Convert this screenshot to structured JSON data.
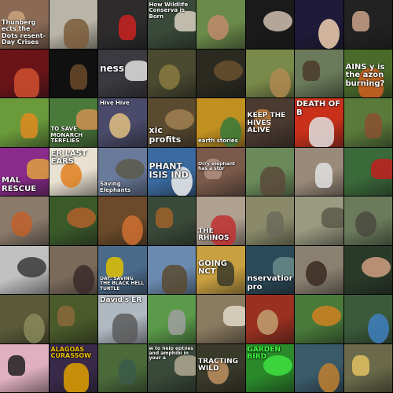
{
  "grid": {
    "cols": 8,
    "rows": 8,
    "tiles": [
      {
        "bg": "#8a6a55",
        "accent": "#c9a27c",
        "caption": "Thunberg ects the Dots resent-Day Crises",
        "cap_pos": "bottom",
        "cap_color": "#ffffff",
        "cap_size": 8
      },
      {
        "bg": "#b8b4a6",
        "accent": "#7a5a3a",
        "caption": "",
        "cap_pos": "",
        "cap_color": "#ffffff",
        "cap_size": 8
      },
      {
        "bg": "#2d2b2b",
        "accent": "#c22",
        "caption": "",
        "cap_pos": "",
        "cap_color": "#ffffff",
        "cap_size": 8
      },
      {
        "bg": "#3a4a3a",
        "accent": "#d8d0c0",
        "caption": "How Wildlife Conserva is Born",
        "cap_pos": "top",
        "cap_color": "#ffffff",
        "cap_size": 7
      },
      {
        "bg": "#6a8a4a",
        "accent": "#c08a6a",
        "caption": "",
        "cap_pos": "",
        "cap_color": "#ffffff",
        "cap_size": 8
      },
      {
        "bg": "#1a1a1a",
        "accent": "#d0c0b0",
        "caption": "",
        "cap_pos": "",
        "cap_color": "#ffffff",
        "cap_size": 8
      },
      {
        "bg": "#1f1a3a",
        "accent": "#f0d0b0",
        "caption": "",
        "cap_pos": "",
        "cap_color": "#ffffff",
        "cap_size": 8
      },
      {
        "bg": "#222222",
        "accent": "#caa28a",
        "caption": "",
        "cap_pos": "",
        "cap_color": "#ffffff",
        "cap_size": 8
      },
      {
        "bg": "#6a1418",
        "accent": "#d05030",
        "caption": "",
        "cap_pos": "",
        "cap_color": "#ffffff",
        "cap_size": 8
      },
      {
        "bg": "#101010",
        "accent": "#6a4a2a",
        "caption": "",
        "cap_pos": "",
        "cap_color": "#ffffff",
        "cap_size": 8
      },
      {
        "bg": "#3a3a40",
        "accent": "#e0e0e0",
        "caption": "ness",
        "cap_pos": "mid",
        "cap_color": "#ffffff",
        "cap_size": 12
      },
      {
        "bg": "#4a4a30",
        "accent": "#8a7a40",
        "caption": "",
        "cap_pos": "",
        "cap_color": "#ffffff",
        "cap_size": 8
      },
      {
        "bg": "#2a2a20",
        "accent": "#6a5030",
        "caption": "",
        "cap_pos": "",
        "cap_color": "#ffffff",
        "cap_size": 8
      },
      {
        "bg": "#7a8a4a",
        "accent": "#b08a50",
        "caption": "",
        "cap_pos": "",
        "cap_color": "#ffffff",
        "cap_size": 8
      },
      {
        "bg": "#6a7a5a",
        "accent": "#4a3a2a",
        "caption": "",
        "cap_pos": "",
        "cap_color": "#ffffff",
        "cap_size": 8
      },
      {
        "bg": "#4a6a2a",
        "accent": "#d06020",
        "caption": "AINS y is the azon burning?",
        "cap_pos": "mid",
        "cap_color": "#ffffff",
        "cap_size": 10
      },
      {
        "bg": "#6a9a3a",
        "accent": "#e08a20",
        "caption": "",
        "cap_pos": "",
        "cap_color": "#ffffff",
        "cap_size": 8
      },
      {
        "bg": "#4a7a3a",
        "accent": "#d09050",
        "caption": "TO SAVE MONARCH TERFLIES",
        "cap_pos": "bottom",
        "cap_color": "#ffffff",
        "cap_size": 7
      },
      {
        "bg": "#4a4a6a",
        "accent": "#e0c080",
        "caption": "Hive Hive",
        "cap_pos": "top",
        "cap_color": "#ffffff",
        "cap_size": 7
      },
      {
        "bg": "#5a4a30",
        "accent": "#a08050",
        "caption": "xic profits",
        "cap_pos": "bottom",
        "cap_color": "#ffffff",
        "cap_size": 11
      },
      {
        "bg": "#c09020",
        "accent": "#3a7a3a",
        "caption": "earth stories",
        "cap_pos": "bottom",
        "cap_color": "#ffffff",
        "cap_size": 7
      },
      {
        "bg": "#4a3a30",
        "accent": "#c08040",
        "caption": "KEEP THE HIVES ALIVE",
        "cap_pos": "mid",
        "cap_color": "#ffffff",
        "cap_size": 9
      },
      {
        "bg": "#c8301a",
        "accent": "#e0e0e0",
        "caption": "DEATH OF B",
        "cap_pos": "top",
        "cap_color": "#ffffff",
        "cap_size": 10
      },
      {
        "bg": "#5a7a3a",
        "accent": "#8a5030",
        "caption": "",
        "cap_pos": "",
        "cap_color": "#ffffff",
        "cap_size": 8
      },
      {
        "bg": "#8a2a8a",
        "accent": "#e0a040",
        "caption": "MAL RESCUE",
        "cap_pos": "bottom",
        "cap_color": "#ffffff",
        "cap_size": 10
      },
      {
        "bg": "#e8e0d0",
        "accent": "#e08020",
        "caption": "ER LAST EARS",
        "cap_pos": "top",
        "cap_color": "#ffffff",
        "cap_size": 10
      },
      {
        "bg": "#6a7a9a",
        "accent": "#5a5a4a",
        "caption": "Saving Elephants",
        "cap_pos": "bottom",
        "cap_color": "#ffffff",
        "cap_size": 7
      },
      {
        "bg": "#3a6aa0",
        "accent": "#f0f0f0",
        "caption": "PHANT ISIS IND",
        "cap_pos": "mid",
        "cap_color": "#ffffff",
        "cap_size": 11
      },
      {
        "bg": "#7a5a4a",
        "accent": "#b09080",
        "caption": "Orry elephant has a stor",
        "cap_pos": "mid",
        "cap_color": "#ffffff",
        "cap_size": 6
      },
      {
        "bg": "#6a8a5a",
        "accent": "#5a4a3a",
        "caption": "",
        "cap_pos": "",
        "cap_color": "#ffffff",
        "cap_size": 8
      },
      {
        "bg": "#9a8a7a",
        "accent": "#e0e0e0",
        "caption": "",
        "cap_pos": "",
        "cap_color": "#ffffff",
        "cap_size": 8
      },
      {
        "bg": "#3a6a3a",
        "accent": "#c02020",
        "caption": "",
        "cap_pos": "",
        "cap_color": "#ffffff",
        "cap_size": 8
      },
      {
        "bg": "#8a7a6a",
        "accent": "#c0602a",
        "caption": "",
        "cap_pos": "",
        "cap_color": "#ffffff",
        "cap_size": 8
      },
      {
        "bg": "#3a5a2a",
        "accent": "#b0602a",
        "caption": "",
        "cap_pos": "",
        "cap_color": "#ffffff",
        "cap_size": 8
      },
      {
        "bg": "#6a4a2a",
        "accent": "#d07030",
        "caption": "",
        "cap_pos": "",
        "cap_color": "#ffffff",
        "cap_size": 8
      },
      {
        "bg": "#3a4a3a",
        "accent": "#a0602a",
        "caption": "",
        "cap_pos": "",
        "cap_color": "#ffffff",
        "cap_size": 8
      },
      {
        "bg": "#b0a090",
        "accent": "#c03030",
        "caption": "THE RHINOS",
        "cap_pos": "bottom",
        "cap_color": "#ffffff",
        "cap_size": 9
      },
      {
        "bg": "#8a8a6a",
        "accent": "#6a6a5a",
        "caption": "",
        "cap_pos": "",
        "cap_color": "#ffffff",
        "cap_size": 8
      },
      {
        "bg": "#9a9a80",
        "accent": "#5a5a4a",
        "caption": "",
        "cap_pos": "",
        "cap_color": "#ffffff",
        "cap_size": 8
      },
      {
        "bg": "#6a7a5a",
        "accent": "#4a4a40",
        "caption": "",
        "cap_pos": "",
        "cap_color": "#ffffff",
        "cap_size": 8
      },
      {
        "bg": "#c0c0c0",
        "accent": "#3a3a3a",
        "caption": "",
        "cap_pos": "",
        "cap_color": "#ffffff",
        "cap_size": 8
      },
      {
        "bg": "#7a6a5a",
        "accent": "#3a2a2a",
        "caption": "",
        "cap_pos": "",
        "cap_color": "#ffffff",
        "cap_size": 8
      },
      {
        "bg": "#4a6a8a",
        "accent": "#e0c000",
        "caption": "DAY: SAVING THE BLACK HELL TURTLE",
        "cap_pos": "bottom",
        "cap_color": "#ffffff",
        "cap_size": 6
      },
      {
        "bg": "#6a8ab0",
        "accent": "#5a4a30",
        "caption": "",
        "cap_pos": "",
        "cap_color": "#ffffff",
        "cap_size": 8
      },
      {
        "bg": "#c8a040",
        "accent": "#3a3a2a",
        "caption": "GOING NCT",
        "cap_pos": "mid",
        "cap_color": "#ffffff",
        "cap_size": 10
      },
      {
        "bg": "#2a4a5a",
        "accent": "#6a8a8a",
        "caption": "nservation pro",
        "cap_pos": "bottom",
        "cap_color": "#ffffff",
        "cap_size": 10
      },
      {
        "bg": "#8a8070",
        "accent": "#3a2a20",
        "caption": "",
        "cap_pos": "",
        "cap_color": "#ffffff",
        "cap_size": 8
      },
      {
        "bg": "#2a3a2a",
        "accent": "#d0a080",
        "caption": "",
        "cap_pos": "",
        "cap_color": "#ffffff",
        "cap_size": 8
      },
      {
        "bg": "#5a5a3a",
        "accent": "#8a8a5a",
        "caption": "",
        "cap_pos": "",
        "cap_color": "#ffffff",
        "cap_size": 8
      },
      {
        "bg": "#4a5a2a",
        "accent": "#8a6a3a",
        "caption": "",
        "cap_pos": "",
        "cap_color": "#ffffff",
        "cap_size": 8
      },
      {
        "bg": "#b0b8c0",
        "accent": "#5a5a5a",
        "caption": "David's ER",
        "cap_pos": "top",
        "cap_color": "#ffffff",
        "cap_size": 9
      },
      {
        "bg": "#5a9a4a",
        "accent": "#a0a0a0",
        "caption": "",
        "cap_pos": "",
        "cap_color": "#ffffff",
        "cap_size": 8
      },
      {
        "bg": "#8a7a60",
        "accent": "#e0d8c8",
        "caption": "",
        "cap_pos": "",
        "cap_color": "#ffffff",
        "cap_size": 8
      },
      {
        "bg": "#9a3020",
        "accent": "#c0a070",
        "caption": "",
        "cap_pos": "",
        "cap_color": "#ffffff",
        "cap_size": 8
      },
      {
        "bg": "#4a7a3a",
        "accent": "#d08020",
        "caption": "",
        "cap_pos": "",
        "cap_color": "#ffffff",
        "cap_size": 8
      },
      {
        "bg": "#3a5a3a",
        "accent": "#4080c0",
        "caption": "",
        "cap_pos": "",
        "cap_color": "#ffffff",
        "cap_size": 8
      },
      {
        "bg": "#e0b0c0",
        "accent": "#202020",
        "caption": "",
        "cap_pos": "",
        "cap_color": "#ffffff",
        "cap_size": 8
      },
      {
        "bg": "#3a2a4a",
        "accent": "#e0a000",
        "caption": "ALAGOAS CURASSOW",
        "cap_pos": "top",
        "cap_color": "#f0c000",
        "cap_size": 8
      },
      {
        "bg": "#4a6a3a",
        "accent": "#3a5a4a",
        "caption": "",
        "cap_pos": "",
        "cap_color": "#ffffff",
        "cap_size": 8
      },
      {
        "bg": "#3a4a3a",
        "accent": "#b0a890",
        "caption": "w to help eptiles and amphibi in your a",
        "cap_pos": "top",
        "cap_color": "#ffffff",
        "cap_size": 6
      },
      {
        "bg": "#3a3a2a",
        "accent": "#c09060",
        "caption": "TRACTING WILD",
        "cap_pos": "mid",
        "cap_color": "#ffffff",
        "cap_size": 9
      },
      {
        "bg": "#2a8a2a",
        "accent": "#40e040",
        "caption": "GARDEN BIRD",
        "cap_pos": "top",
        "cap_color": "#40ff40",
        "cap_size": 9
      },
      {
        "bg": "#3a5a6a",
        "accent": "#c08030",
        "caption": "",
        "cap_pos": "",
        "cap_color": "#ffffff",
        "cap_size": 8
      },
      {
        "bg": "#6a6a4a",
        "accent": "#e0c060",
        "caption": "",
        "cap_pos": "",
        "cap_color": "#ffffff",
        "cap_size": 8
      }
    ]
  }
}
